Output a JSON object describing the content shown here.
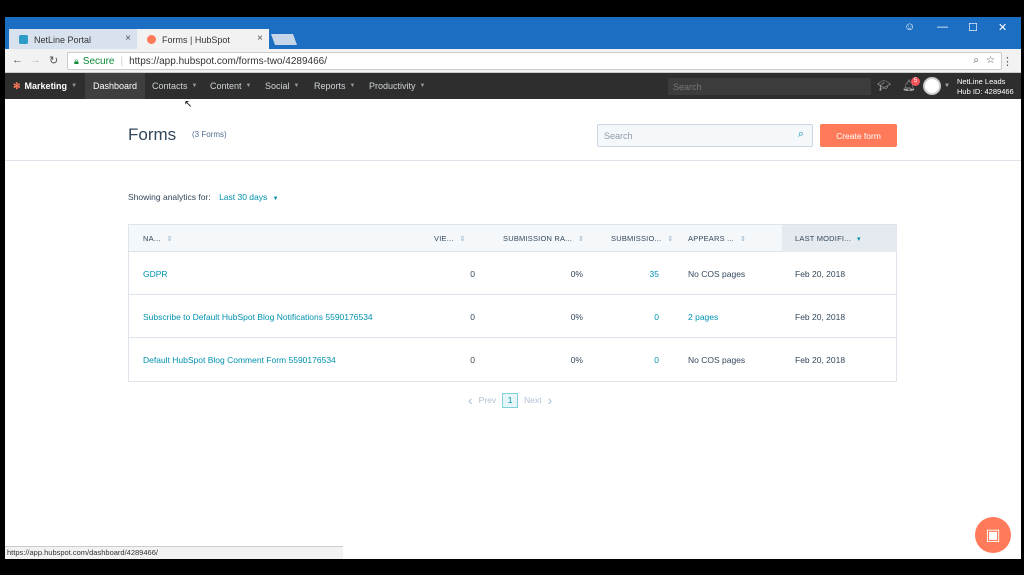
{
  "browser": {
    "tabs": [
      {
        "label": "NetLine Portal"
      },
      {
        "label": "Forms | HubSpot"
      }
    ],
    "tab_close": "×",
    "secure_label": "Secure",
    "url": "https://app.hubspot.com/forms-two/4289466/",
    "status_url": "https://app.hubspot.com/dashboard/4289466/"
  },
  "hubspot_nav": {
    "brand": "Marketing",
    "items": [
      {
        "label": "Dashboard"
      },
      {
        "label": "Contacts"
      },
      {
        "label": "Content"
      },
      {
        "label": "Social"
      },
      {
        "label": "Reports"
      },
      {
        "label": "Productivity"
      }
    ],
    "search_placeholder": "Search",
    "notification_count": "5",
    "account_name": "NetLine Leads",
    "hub_id": "Hub ID: 4289466"
  },
  "page": {
    "title": "Forms",
    "count": "(3 Forms)",
    "search_placeholder": "Search",
    "create_button": "Create form",
    "analytics_label": "Showing analytics for:",
    "analytics_period": "Last 30 days"
  },
  "table": {
    "columns": [
      "NA...",
      "VIE...",
      "SUBMISSION RA...",
      "SUBMISSIO...",
      "APPEARS ...",
      "LAST MODIFI..."
    ],
    "rows": [
      {
        "name": "GDPR",
        "views": "0",
        "rate": "0%",
        "submissions": "35",
        "appears": "No COS pages",
        "modified": "Feb 20, 2018"
      },
      {
        "name": "Subscribe to Default HubSpot Blog Notifications 5590176534",
        "views": "0",
        "rate": "0%",
        "submissions": "0",
        "appears": "2 pages",
        "modified": "Feb 20, 2018"
      },
      {
        "name": "Default HubSpot Blog Comment Form 5590176534",
        "views": "0",
        "rate": "0%",
        "submissions": "0",
        "appears": "No COS pages",
        "modified": "Feb 20, 2018"
      }
    ]
  },
  "pagination": {
    "prev": "Prev",
    "page": "1",
    "next": "Next"
  },
  "colors": {
    "accent": "#ff7a59",
    "link": "#0091ae",
    "nav_bg": "#2e2e2e"
  }
}
